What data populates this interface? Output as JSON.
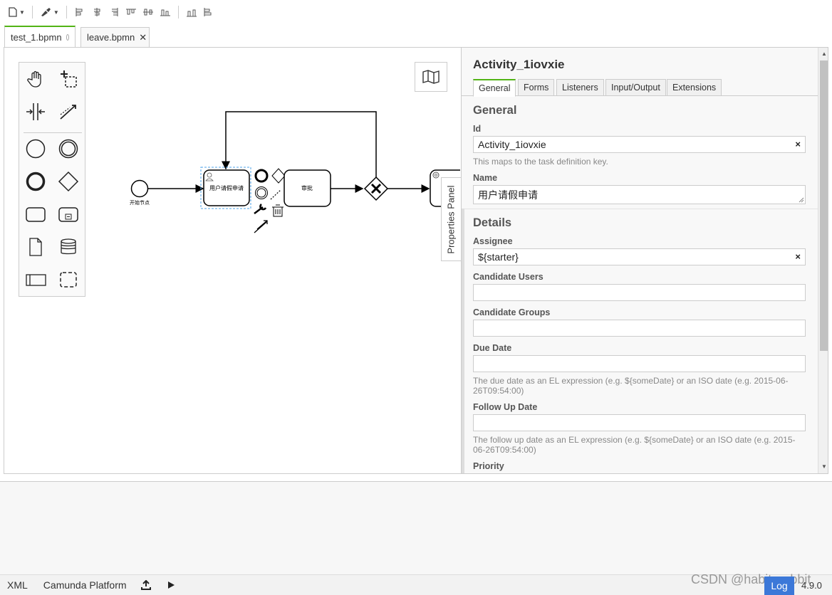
{
  "tabs": [
    {
      "label": "test_1.bpmn",
      "active": true
    },
    {
      "label": "leave.bpmn",
      "active": false
    }
  ],
  "diagram": {
    "start_label": "开始节点",
    "task1_label": "用户请假申请",
    "task2_label": "审批"
  },
  "properties": {
    "toggle_label": "Properties Panel",
    "title": "Activity_1iovxie",
    "tabs": [
      "General",
      "Forms",
      "Listeners",
      "Input/Output",
      "Extensions"
    ],
    "active_tab": "General",
    "general_heading": "General",
    "id_label": "Id",
    "id_value": "Activity_1iovxie",
    "id_hint": "This maps to the task definition key.",
    "name_label": "Name",
    "name_value": "用户请假申请",
    "details_heading": "Details",
    "assignee_label": "Assignee",
    "assignee_value": "${starter}",
    "candidate_users_label": "Candidate Users",
    "candidate_groups_label": "Candidate Groups",
    "due_date_label": "Due Date",
    "due_date_hint": "The due date as an EL expression (e.g. ${someDate} or an ISO date (e.g. 2015-06-26T09:54:00)",
    "follow_up_label": "Follow Up Date",
    "follow_up_hint": "The follow up date as an EL expression (e.g. ${someDate} or an ISO date (e.g. 2015-06-26T09:54:00)",
    "priority_label": "Priority",
    "clear_symbol": "×"
  },
  "statusbar": {
    "xml": "XML",
    "platform": "Camunda Platform",
    "log": "Log",
    "version": "4.9.0"
  },
  "watermark": "CSDN @habit_rabbit",
  "colors": {
    "accent": "#52b415",
    "log_button": "#3c78d8"
  }
}
